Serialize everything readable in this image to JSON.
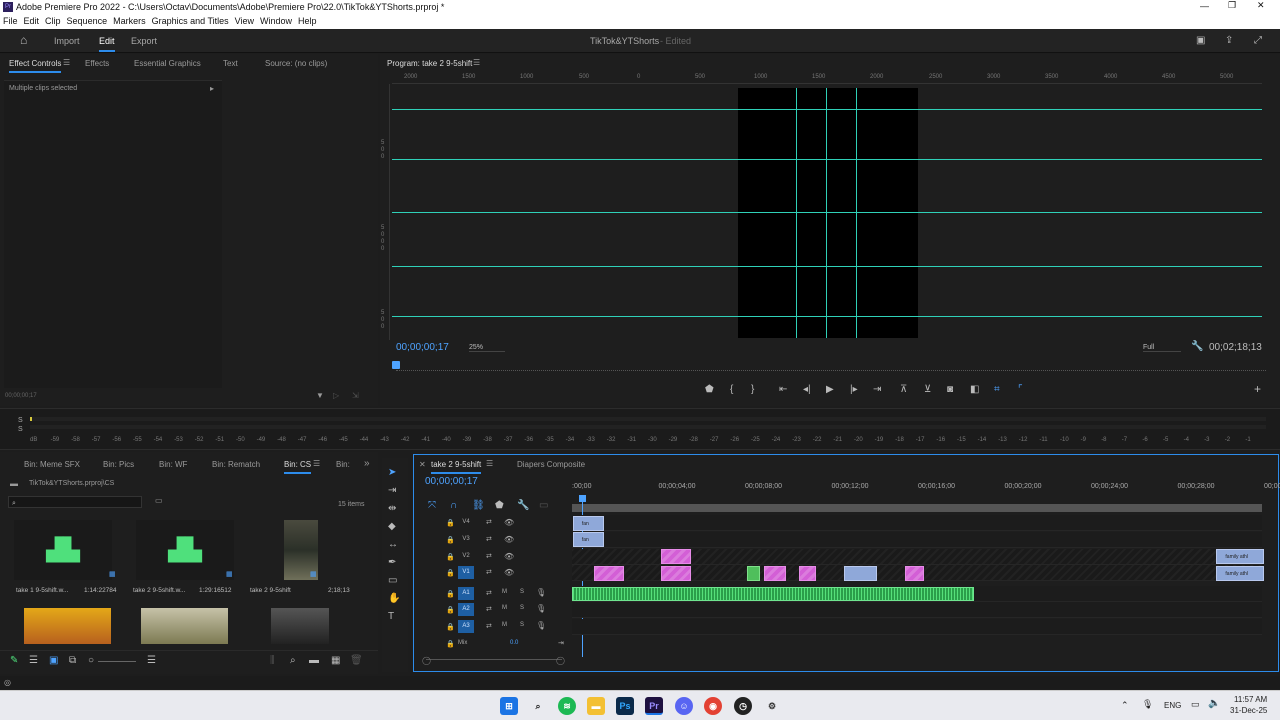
{
  "window": {
    "title": "Adobe Premiere Pro 2022 - C:\\Users\\Octav\\Documents\\Adobe\\Premiere Pro\\22.0\\TikTok&YTShorts.prproj *"
  },
  "menu": [
    "File",
    "Edit",
    "Clip",
    "Sequence",
    "Markers",
    "Graphics and Titles",
    "View",
    "Window",
    "Help"
  ],
  "workspace": {
    "tabs": [
      "Import",
      "Edit",
      "Export"
    ],
    "active": "Edit",
    "project": "TikTok&YTShorts",
    "status": "- Edited"
  },
  "source_panel": {
    "tabs": [
      "Effect Controls",
      "Effects",
      "Essential Graphics",
      "Text",
      "Source: (no clips)"
    ],
    "message": "Multiple clips selected",
    "timecode": "00;00;00;17"
  },
  "program": {
    "title": "Program: take 2 9-5shift",
    "timecode": "00;00;00;17",
    "zoom": "25%",
    "quality": "Full",
    "duration": "00;02;18;13",
    "ruler": [
      "2000",
      "1500",
      "1000",
      "500",
      "0",
      "500",
      "1000",
      "1500",
      "2000",
      "2500",
      "3000",
      "3500",
      "4000",
      "4500",
      "5000"
    ],
    "left_ruler": [
      "5",
      "0",
      "0",
      "5",
      "0",
      "0",
      "0",
      "5",
      "0",
      "0",
      "5",
      "0",
      "5",
      "0",
      "0"
    ]
  },
  "meter": {
    "scale": [
      "dB",
      "-59",
      "-58",
      "-57",
      "-56",
      "-55",
      "-54",
      "-53",
      "-52",
      "-51",
      "-50",
      "-49",
      "-48",
      "-47",
      "-46",
      "-45",
      "-44",
      "-43",
      "-42",
      "-41",
      "-40",
      "-39",
      "-38",
      "-37",
      "-36",
      "-35",
      "-34",
      "-33",
      "-32",
      "-31",
      "-30",
      "-29",
      "-28",
      "-27",
      "-26",
      "-25",
      "-24",
      "-23",
      "-22",
      "-21",
      "-20",
      "-19",
      "-18",
      "-17",
      "-16",
      "-15",
      "-14",
      "-13",
      "-12",
      "-11",
      "-10",
      "-9",
      "-8",
      "-7",
      "-6",
      "-5",
      "-4",
      "-3",
      "-2",
      "-1"
    ],
    "ss": [
      "S",
      "S"
    ]
  },
  "project_panel": {
    "tabs": [
      "Bin: Meme SFX",
      "Bin: Pics",
      "Bin: WF",
      "Bin: Rematch",
      "Bin: CS",
      "Bin:"
    ],
    "path": "TikTok&YTShorts.prproj\\CS",
    "count": "15 items",
    "items": [
      {
        "name": "take 1 9-5shift.w...",
        "dur": "1:14:22784"
      },
      {
        "name": "take 2 9-5shift.w...",
        "dur": "1:29:16512"
      },
      {
        "name": "take 2 9-5shift",
        "dur": "2;18;13"
      }
    ]
  },
  "timeline": {
    "tabs": [
      "take 2 9-5shift",
      "Diapers Composite"
    ],
    "timecode": "00;00;00;17",
    "ruler": [
      ":00;00",
      "00;00;04;00",
      "00;00;08;00",
      "00;00;12;00",
      "00;00;16;00",
      "00;00;20;00",
      "00;00;24;00",
      "00;00;28;00",
      "00;00;"
    ],
    "video_tracks": [
      "V4",
      "V3",
      "V2",
      "V1"
    ],
    "audio_tracks": [
      "A1",
      "A2",
      "A3"
    ],
    "mix": "Mix",
    "mix_val": "0.0",
    "clip_fan": "fan",
    "clip_family": "family athl"
  },
  "taskbar": {
    "lang": "ENG",
    "time": "11:57 AM",
    "date": "31-Dec-25"
  },
  "colors": {
    "accent": "#2d8ceb",
    "guide": "#2fd1b8",
    "pink": "#d35fd6",
    "blue": "#8fa8d9",
    "green": "#4fbf5c"
  }
}
